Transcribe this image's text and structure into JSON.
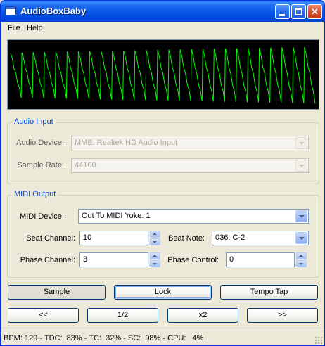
{
  "window": {
    "title": "AudioBoxBaby",
    "icon": "app-window-icon"
  },
  "menu": {
    "items": [
      "File",
      "Help"
    ]
  },
  "waveform": {
    "trace_color": "#00ff00",
    "background": "#000000",
    "cycles": 27
  },
  "audio_input": {
    "title": "Audio Input",
    "device_label": "Audio Device:",
    "device_value": "MME: Realtek HD Audio Input",
    "rate_label": "Sample Rate:",
    "rate_value": "44100",
    "enabled": false
  },
  "midi_output": {
    "title": "MIDI Output",
    "device_label": "MIDI Device:",
    "device_value": "Out To MIDI Yoke:  1",
    "beat_channel_label": "Beat Channel:",
    "beat_channel_value": "10",
    "beat_note_label": "Beat Note:",
    "beat_note_value": "036: C-2",
    "phase_channel_label": "Phase Channel:",
    "phase_channel_value": "3",
    "phase_control_label": "Phase Control:",
    "phase_control_value": "0"
  },
  "buttons": {
    "sample": "Sample",
    "lock": "Lock",
    "tempo_tap": "Tempo Tap",
    "prev": "<<",
    "half": "1/2",
    "double": "x2",
    "next": ">>"
  },
  "status": {
    "text": "BPM: 129 - TDC:  83% - TC:  32% - SC:  98% - CPU:   4%"
  },
  "colors": {
    "group_title": "#0046d5",
    "titlebar": "#0554e4"
  }
}
